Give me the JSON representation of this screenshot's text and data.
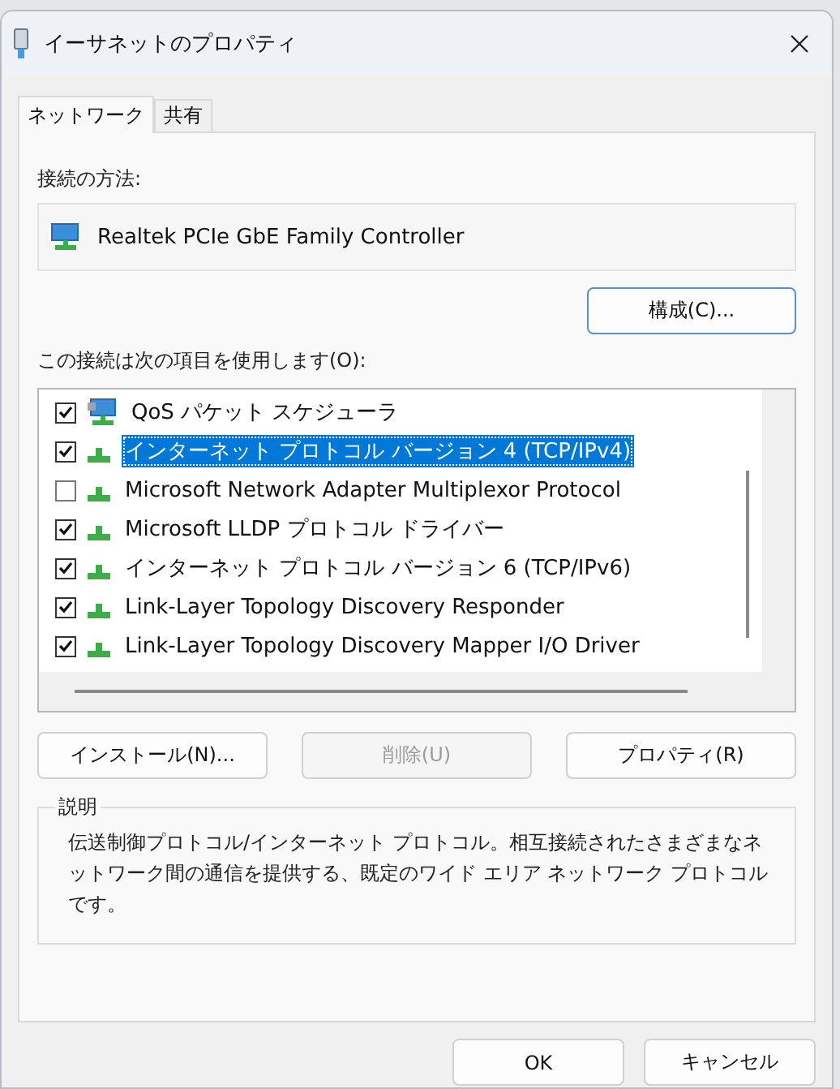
{
  "window": {
    "title": "イーサネットのプロパティ"
  },
  "tabs": [
    {
      "label": "ネットワーク",
      "selected": true
    },
    {
      "label": "共有",
      "selected": false
    }
  ],
  "connect_using": {
    "label": "接続の方法:",
    "adapter": "Realtek PCIe GbE Family Controller",
    "configure_button": "構成(C)..."
  },
  "items_label": "この接続は次の項目を使用します(O):",
  "items": [
    {
      "kind": "scheduler",
      "label": "QoS パケット スケジューラ",
      "checked": true,
      "selected": false
    },
    {
      "kind": "protocol",
      "label": "インターネット プロトコル バージョン 4 (TCP/IPv4)",
      "checked": true,
      "selected": true
    },
    {
      "kind": "protocol",
      "label": "Microsoft Network Adapter Multiplexor Protocol",
      "checked": false,
      "selected": false
    },
    {
      "kind": "protocol",
      "label": "Microsoft LLDP プロトコル ドライバー",
      "checked": true,
      "selected": false
    },
    {
      "kind": "protocol",
      "label": "インターネット プロトコル バージョン 6 (TCP/IPv6)",
      "checked": true,
      "selected": false
    },
    {
      "kind": "protocol",
      "label": "Link-Layer Topology Discovery Responder",
      "checked": true,
      "selected": false
    },
    {
      "kind": "protocol",
      "label": "Link-Layer Topology Discovery Mapper I/O Driver",
      "checked": true,
      "selected": false
    }
  ],
  "item_buttons": [
    {
      "label": "インストール(N)...",
      "disabled": false
    },
    {
      "label": "削除(U)",
      "disabled": true
    },
    {
      "label": "プロパティ(R)",
      "disabled": false
    }
  ],
  "description": {
    "title": "説明",
    "text": "伝送制御プロトコル/インターネット プロトコル。相互接続されたさまざまなネットワーク間の通信を提供する、既定のワイド エリア ネットワーク プロトコルです。"
  },
  "dialog_buttons": [
    "OK",
    "キャンセル"
  ]
}
